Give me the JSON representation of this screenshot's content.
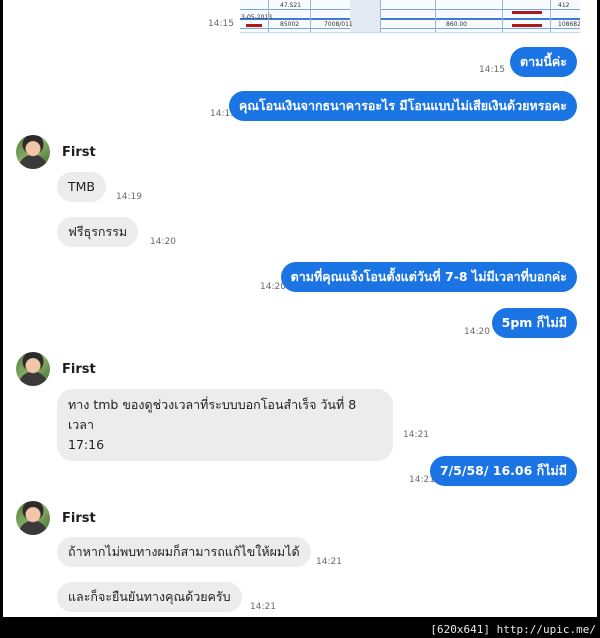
{
  "conversation": {
    "contact_name": "First",
    "screenshot_strip": {
      "time": "14:15",
      "cells": [
        "47.S21",
        "85002",
        "7008/011",
        "860.00",
        "108682",
        "3-05-2013",
        "412"
      ]
    },
    "messages": [
      {
        "id": "m1",
        "side": "out",
        "text": "ตามนี้ค่ะ",
        "time": "14:15"
      },
      {
        "id": "m2",
        "side": "out",
        "text": "คุณโอนเงินจากธนาคารอะไร มีโอนแบบไม่เสียเงินด้วยหรอคะ",
        "time": "14:19"
      },
      {
        "id": "m3",
        "side": "in",
        "text": "TMB",
        "time": "14:19"
      },
      {
        "id": "m4",
        "side": "in",
        "text": "ฟรีธุรกรรม",
        "time": "14:20"
      },
      {
        "id": "m5",
        "side": "out",
        "text": "ตามที่คุณแจ้งโอนตั้งแต่วันที่ 7-8 ไม่มีเวลาที่บอกค่ะ",
        "time": "14:20"
      },
      {
        "id": "m6",
        "side": "out",
        "text": "5pm ก็ไม่มี",
        "time": "14:20"
      },
      {
        "id": "m7",
        "side": "in",
        "text_line1": "ทาง tmb ของดูช่วงเวลาที่ระบบบอกโอนสำเร็จ วันที่ 8 เวลา",
        "text_line2": "17:16",
        "time": "14:21"
      },
      {
        "id": "m8",
        "side": "out",
        "text": "7/5/58/ 16.06 ก็ไม่มี",
        "time": "14:21"
      },
      {
        "id": "m9",
        "side": "in",
        "text": "ถ้าหากไม่พบทางผมก็สามารถแก้ไขให้ผมได้",
        "time": "14:21"
      },
      {
        "id": "m10",
        "side": "in",
        "text": "และก็จะยืนยันทางคุณด้วยครับ",
        "time": "14:21"
      }
    ]
  },
  "watermark": "[620x641] http://upic.me/",
  "colors": {
    "outgoing_bubble": "#1b74e4",
    "incoming_bubble": "#ececec",
    "background": "#ffffff",
    "frame": "#000000"
  }
}
